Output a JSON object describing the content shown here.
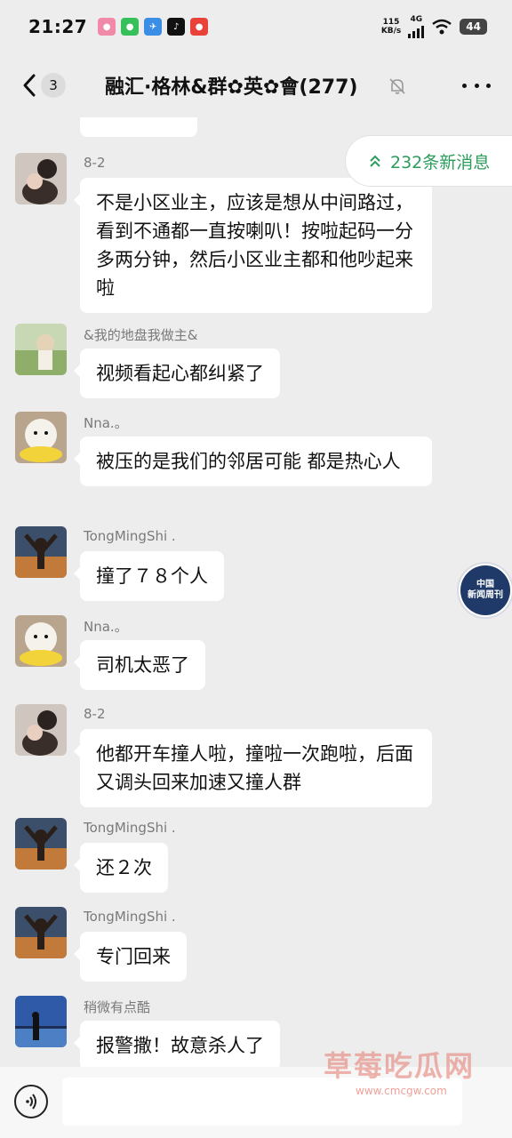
{
  "status_bar": {
    "time": "21:27",
    "net_speed": "115",
    "net_unit": "KB/s",
    "net_type": "4G",
    "battery": "44"
  },
  "header": {
    "back_icon": "chevron-left-icon",
    "unread_count": "3",
    "title": "融汇·格林&群✿英✿會(277)",
    "mute_icon": "bell-off-icon",
    "more_icon": "more-dots-icon"
  },
  "new_messages_pill": {
    "icon": "double-chevron-up-icon",
    "label": "232条新消息",
    "color": "#2a9d5c"
  },
  "messages": [
    {
      "sender": "8-2",
      "text": "不是小区业主，应该是想从中间路过，看到不通都一直按喇叭！按啦起码一分多两分钟，然后小区业主都和他吵起来啦"
    },
    {
      "sender": "&我的地盘我做主&",
      "text": "视频看起心都纠紧了"
    },
    {
      "sender": "Nna.。",
      "text": "被压的是我们的邻居可能 都是热心人"
    },
    {
      "sender": "TongMingShi .",
      "text": "撞了７８个人"
    },
    {
      "sender": "Nna.。",
      "text": "司机太恶了"
    },
    {
      "sender": "8-2",
      "text": "他都开车撞人啦，撞啦一次跑啦，后面又调头回来加速又撞人群"
    },
    {
      "sender": "TongMingShi .",
      "text": "还２次"
    },
    {
      "sender": "TongMingShi .",
      "text": "专门回来"
    },
    {
      "sender": "稍微有点酷",
      "text": "报警撒！故意杀人了"
    }
  ],
  "badge": {
    "line1": "中国",
    "line2": "新闻周刊"
  },
  "input_bar": {
    "voice_icon": "voice-icon",
    "placeholder": ""
  },
  "watermark": {
    "text": "草莓吃瓜网",
    "url": "www.cmcgw.com"
  }
}
